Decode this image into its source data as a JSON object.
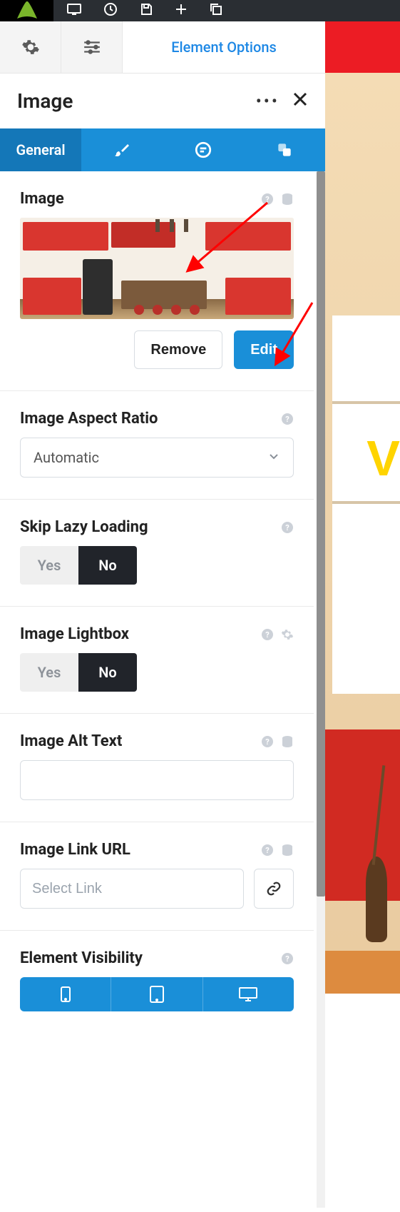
{
  "header": {
    "element_options_label": "Element Options"
  },
  "panel": {
    "title": "Image",
    "tabs": {
      "general": "General"
    }
  },
  "image_section": {
    "heading": "Image",
    "remove_label": "Remove",
    "edit_label": "Edit"
  },
  "aspect_ratio": {
    "heading": "Image Aspect Ratio",
    "selected": "Automatic"
  },
  "lazy_loading": {
    "heading": "Skip Lazy Loading",
    "yes": "Yes",
    "no": "No",
    "value": "No"
  },
  "lightbox": {
    "heading": "Image Lightbox",
    "yes": "Yes",
    "no": "No",
    "value": "No"
  },
  "alt_text": {
    "heading": "Image Alt Text",
    "value": ""
  },
  "link_url": {
    "heading": "Image Link URL",
    "placeholder": "Select Link",
    "value": ""
  },
  "visibility": {
    "heading": "Element Visibility"
  },
  "right_bg": {
    "letter_fragment": "V"
  }
}
